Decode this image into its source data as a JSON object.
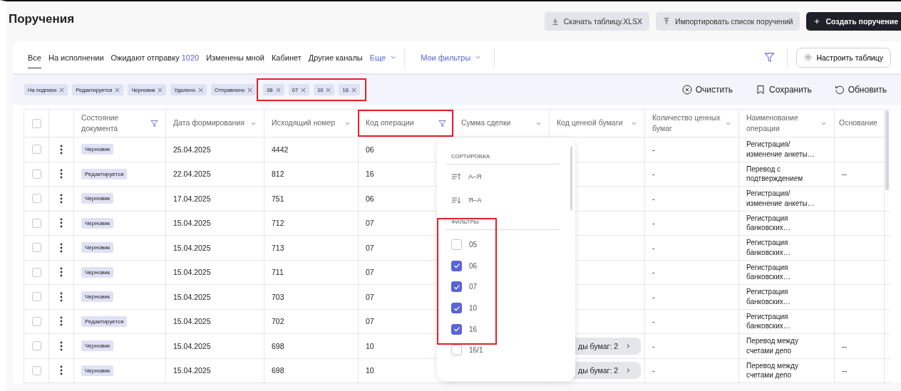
{
  "page": {
    "title": "Поручения"
  },
  "actions": [
    {
      "label": "Скачать таблицу.XLSX",
      "kind": "download"
    },
    {
      "label": "Импортировать список поручений",
      "kind": "upload"
    },
    {
      "label": "Создать поручение",
      "kind": "create"
    }
  ],
  "tabs": [
    {
      "label": "Все",
      "selected": true
    },
    {
      "label": "На исполнении",
      "selected": false
    },
    {
      "label": "Ожидают отправку",
      "count": "1020",
      "selected": false
    },
    {
      "label": "Изменены мной",
      "selected": false
    },
    {
      "label": "Кабинет",
      "selected": false
    },
    {
      "label": "Другие каналы",
      "selected": false
    }
  ],
  "more_menu": {
    "label": "Еще"
  },
  "filters_menu": {
    "label": "Мои фильтры"
  },
  "filter_active": true,
  "table_settings": {
    "label": "Настроить таблицу"
  },
  "chip_groups": [
    {
      "highlighted": false,
      "chips": [
        "На подписи",
        "Редактируется",
        "Черновик",
        "Удалено",
        "Отправлено"
      ]
    },
    {
      "highlighted": true,
      "chips": [
        "06",
        "07",
        "10",
        "16"
      ]
    }
  ],
  "chip_actions": [
    {
      "label": "Очистить",
      "kind": "clear"
    },
    {
      "label": "Сохранить",
      "kind": "save"
    },
    {
      "label": "Обновить",
      "kind": "refresh"
    }
  ],
  "select_all": {
    "checked": false
  },
  "columns": [
    {
      "label": "Состояние документа",
      "filtered": true,
      "highlighted": false
    },
    {
      "label": "Дата формирования",
      "filtered": false,
      "sortable": true,
      "highlighted": false
    },
    {
      "label": "Исходящий номер",
      "filtered": false,
      "sortable": true,
      "highlighted": false
    },
    {
      "label": "Код операции",
      "filtered": true,
      "highlighted": true
    },
    {
      "label": "Сумма сделки",
      "filtered": false,
      "sortable": true,
      "highlighted": false
    },
    {
      "label": "Код ценной бумаги",
      "filtered": false,
      "sortable": true,
      "highlighted": false
    },
    {
      "label": "Количество ценных бумаг",
      "filtered": false,
      "sortable": true,
      "highlighted": false
    },
    {
      "label": "Наименование операции",
      "filtered": false,
      "sortable": true,
      "highlighted": false
    },
    {
      "label": "Основание",
      "filtered": false,
      "sortable": false,
      "highlighted": false
    }
  ],
  "rows": [
    {
      "checked": false,
      "status": "Черновик",
      "date": "25.04.2025",
      "number": "4442",
      "code": "06",
      "quantity": "-",
      "operation": "Регистрация/ изменение анкеты…"
    },
    {
      "checked": false,
      "status": "Редактируется",
      "date": "22.04.2025",
      "number": "812",
      "code": "16",
      "quantity": "-",
      "operation": "Перевод с подтверждением",
      "basis": "--"
    },
    {
      "checked": false,
      "status": "Черновик",
      "date": "17.04.2025",
      "number": "751",
      "code": "06",
      "quantity": "-",
      "operation": "Регистрация/ изменение анкеты…"
    },
    {
      "checked": false,
      "status": "Черновик",
      "date": "15.04.2025",
      "number": "712",
      "code": "07",
      "quantity": "-",
      "operation": "Регистрация банковских…"
    },
    {
      "checked": false,
      "status": "Черновик",
      "date": "15.04.2025",
      "number": "713",
      "code": "07",
      "quantity": "-",
      "operation": "Регистрация банковских…"
    },
    {
      "checked": false,
      "status": "Черновик",
      "date": "15.04.2025",
      "number": "711",
      "code": "07",
      "quantity": "-",
      "operation": "Регистрация банковских…"
    },
    {
      "checked": false,
      "status": "Черновик",
      "date": "15.04.2025",
      "number": "703",
      "code": "07",
      "quantity": "-",
      "operation": "Регистрация банковских…"
    },
    {
      "checked": false,
      "status": "Редактируется",
      "date": "15.04.2025",
      "number": "702",
      "code": "07",
      "quantity": "-",
      "operation": "Регистрация банковских…"
    },
    {
      "checked": false,
      "status": "Черновик",
      "date": "15.04.2025",
      "number": "698",
      "code": "10",
      "securities": "ды бумаг: 2",
      "quantity": "-",
      "operation": "Перевод между счетами депо",
      "basis": "--"
    },
    {
      "checked": false,
      "status": "Черновик",
      "date": "15.04.2025",
      "number": "698",
      "code": "10",
      "securities": "ды бумаг: 2",
      "quantity": "-",
      "operation": "Перевод между счетами депо",
      "basis": "--"
    }
  ],
  "column_menu": {
    "sort_title": "СОРТИРОВКА",
    "sort_options": [
      {
        "label": "А–Я",
        "kind": "asc"
      },
      {
        "label": "Я–А",
        "kind": "desc"
      }
    ],
    "filter_title": "ФИЛЬТРЫ",
    "filters_highlighted": true,
    "options": [
      {
        "label": "05",
        "checked": false
      },
      {
        "label": "06",
        "checked": true
      },
      {
        "label": "07",
        "checked": true
      },
      {
        "label": "10",
        "checked": true
      },
      {
        "label": "16",
        "checked": true
      },
      {
        "label": "16/1",
        "checked": false
      }
    ]
  }
}
